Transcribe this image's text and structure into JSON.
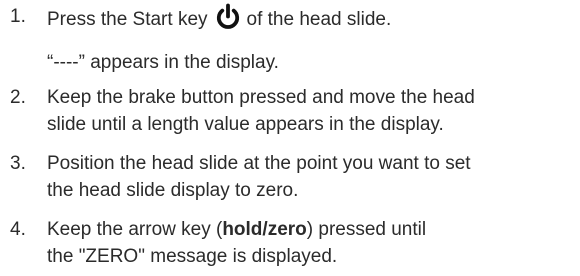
{
  "steps": [
    {
      "number": "1.",
      "line1_before_icon": "Press the Start key",
      "line1_after_icon": "of the head slide.",
      "note": "“----” appears in the display.",
      "icon": "power-icon"
    },
    {
      "number": "2.",
      "line1": "Keep the brake button pressed and move the head",
      "line2": "slide until a length value appears in the display."
    },
    {
      "number": "3.",
      "line1": "Position the head slide at the point you want to set",
      "line2": "the head slide display to zero."
    },
    {
      "number": "4.",
      "line1_before_bold": "Keep the arrow key (",
      "bold": "hold/zero",
      "line1_after_bold": ") pressed until",
      "line2": "the \"ZERO\" message is displayed."
    }
  ]
}
